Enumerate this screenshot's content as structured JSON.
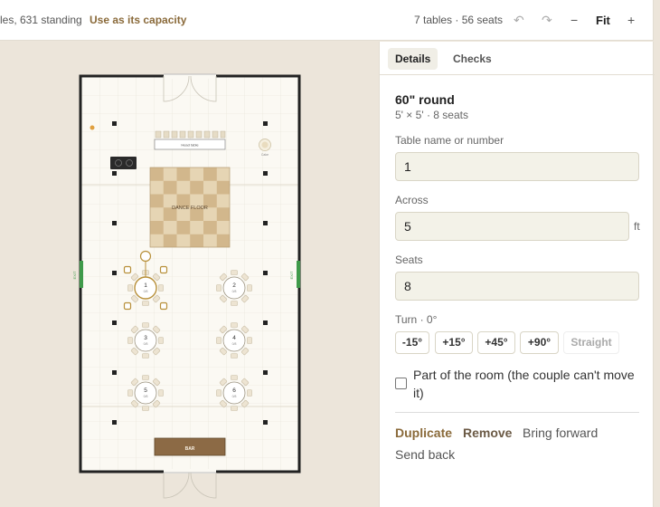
{
  "topbar": {
    "info": "les, 631 standing",
    "use_capacity": "Use as its capacity",
    "count": "7 tables · 56 seats",
    "undo_icon": "↶",
    "redo_icon": "↷",
    "zoom_out": "−",
    "fit": "Fit",
    "zoom_in": "+"
  },
  "floor": {
    "head_table": "Head table",
    "dance_floor": "DANCE FLOOR",
    "bar": "BAR",
    "cake_label": "Cake",
    "exit_label": "EXIT",
    "tables": [
      {
        "number": "1",
        "seats": "0/8"
      },
      {
        "number": "2",
        "seats": "0/8"
      },
      {
        "number": "3",
        "seats": "0/8"
      },
      {
        "number": "4",
        "seats": "0/8"
      },
      {
        "number": "5",
        "seats": "0/8"
      },
      {
        "number": "6",
        "seats": "0/8"
      }
    ]
  },
  "panel": {
    "tabs": [
      "Details",
      "Checks"
    ],
    "title": "60\" round",
    "subtitle": "5' × 5' · 8 seats",
    "name_label": "Table name or number",
    "name_value": "1",
    "across_label": "Across",
    "across_value": "5",
    "across_unit": "ft",
    "seats_label": "Seats",
    "seats_value": "8",
    "turn_label": "Turn · 0°",
    "turn_buttons": [
      "-15°",
      "+15°",
      "+45°",
      "+90°",
      "Straight"
    ],
    "fixed_label": "Part of the room (the couple can't move it)",
    "actions": {
      "duplicate": "Duplicate",
      "remove": "Remove",
      "bring_forward": "Bring forward",
      "send_back": "Send back"
    }
  },
  "colors": {
    "accent": "#8a6a3a",
    "selected": "#b8903a",
    "bar": "#8c6a45",
    "exit": "#3f9a4a"
  }
}
